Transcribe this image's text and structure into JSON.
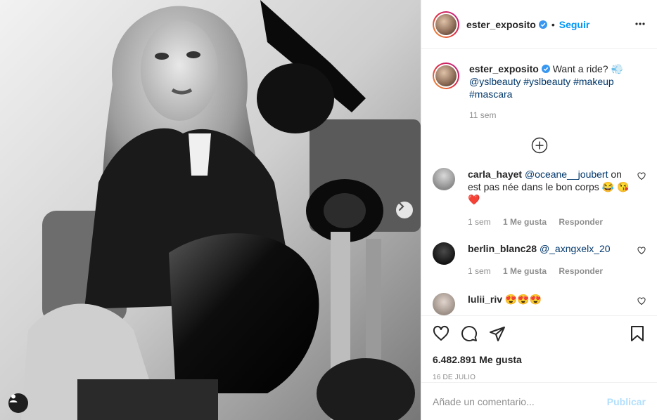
{
  "post": {
    "image_alt": "Black and white photo of a woman on a motorcycle"
  },
  "header": {
    "username": "ester_exposito",
    "dot": "•",
    "follow_label": "Seguir",
    "more_icon": "more-icon"
  },
  "caption": {
    "username": "ester_exposito",
    "text": "Want a ride?",
    "emoji": "💨",
    "mention": "@yslbeauty",
    "tags": [
      "#yslbeauty",
      "#makeup",
      "#mascara"
    ],
    "time": "11 sem"
  },
  "comments": [
    {
      "username": "carla_hayet",
      "mention": "@oceane__joubert",
      "text": " on est pas née dans le bon corps 😂 😘❤️",
      "time": "1 sem",
      "likes": "1 Me gusta",
      "reply": "Responder"
    },
    {
      "username": "berlin_blanc28",
      "mention": "@_axngxelx_20",
      "text": "",
      "time": "1 sem",
      "likes": "1 Me gusta",
      "reply": "Responder"
    },
    {
      "username": "lulii_riv",
      "mention": "",
      "text": "😍😍😍",
      "time": "",
      "likes": "",
      "reply": ""
    }
  ],
  "actions": {
    "likes_count": "6.482.891 Me gusta",
    "date": "16 DE JULIO"
  },
  "add_comment": {
    "placeholder": "Añade un comentario...",
    "publish_label": "Publicar"
  },
  "colors": {
    "accent": "#0095f6",
    "hashtag": "#00376b",
    "muted": "#8e8e8e",
    "publish_disabled": "#b2dffc"
  }
}
